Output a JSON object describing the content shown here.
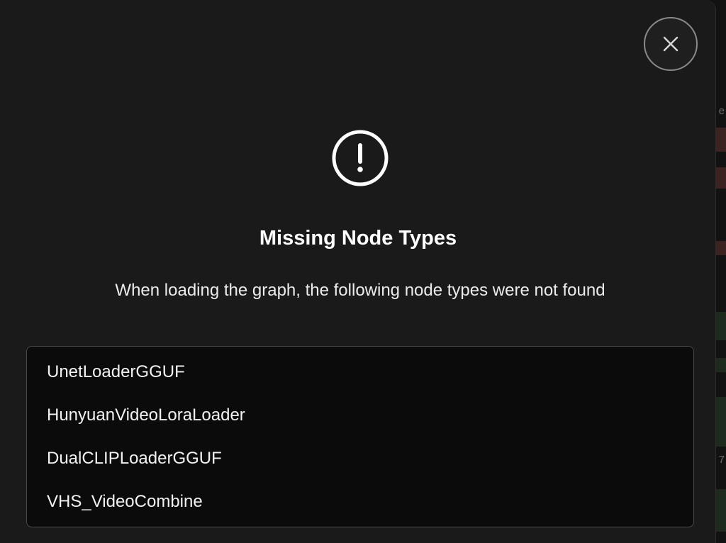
{
  "dialog": {
    "title": "Missing Node Types",
    "message": "When loading the graph, the following node types were not found",
    "close_icon": "close-icon",
    "alert_icon": "exclamation-circle-icon",
    "missing_nodes": [
      "UnetLoaderGGUF",
      "HunyuanVideoLoraLoader",
      "DualCLIPLoaderGGUF",
      "VHS_VideoCombine"
    ]
  },
  "background": {
    "edge_glyph_1": "e",
    "edge_glyph_2": "7"
  },
  "colors": {
    "dialog_bg": "#1a1a1b",
    "list_bg": "#0b0b0b",
    "text": "#ffffff"
  }
}
